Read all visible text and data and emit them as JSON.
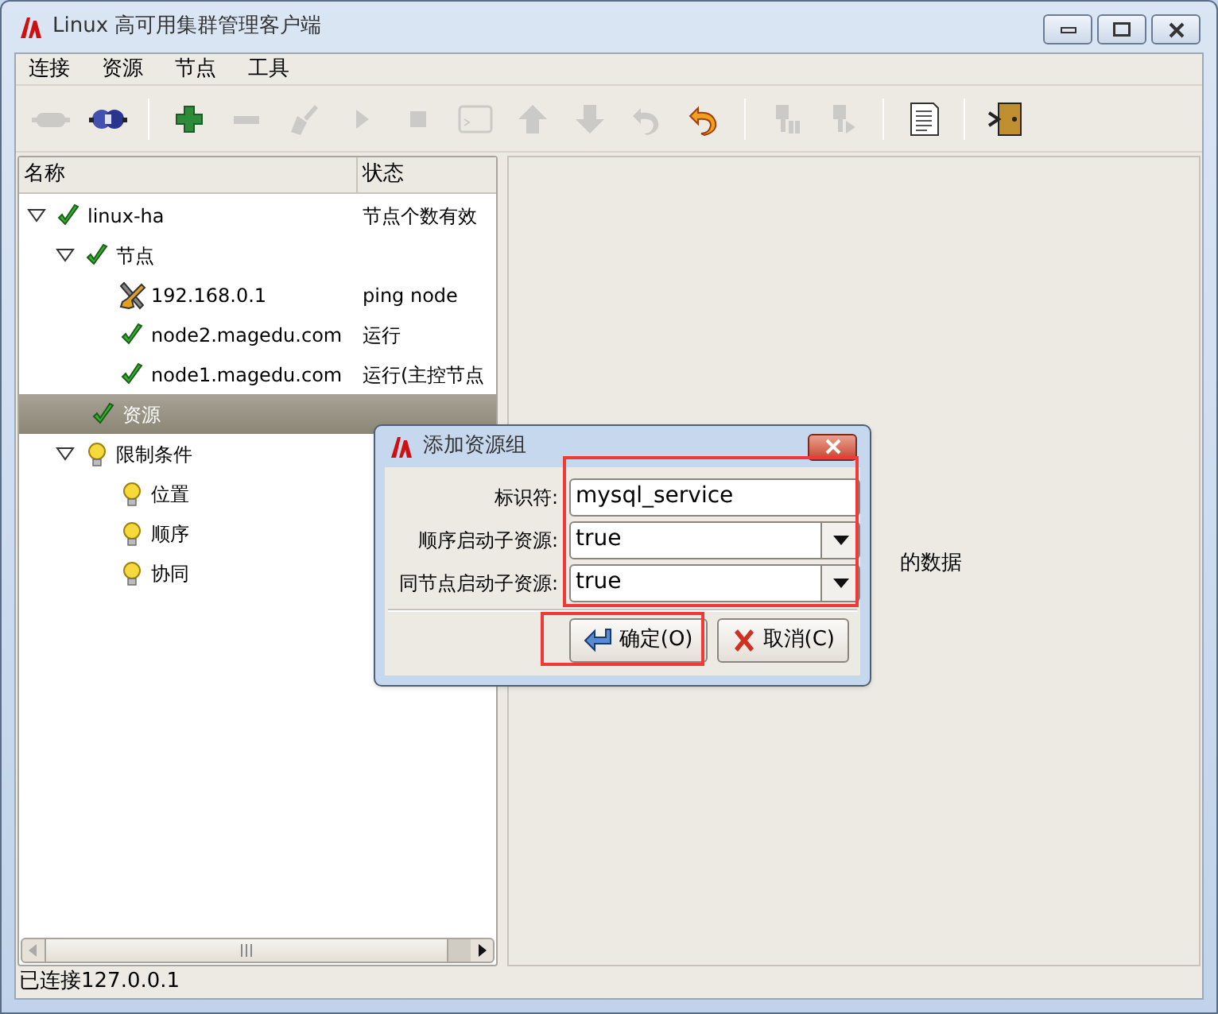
{
  "window": {
    "title": "Linux 高可用集群管理客户端"
  },
  "menu": [
    "连接",
    "资源",
    "节点",
    "工具"
  ],
  "toolbar": [
    {
      "kind": "button",
      "disabled": true
    },
    {
      "kind": "button",
      "disabled": false
    },
    {
      "kind": "separator"
    },
    {
      "kind": "button",
      "disabled": false
    },
    {
      "kind": "button",
      "disabled": true
    },
    {
      "kind": "button",
      "disabled": true
    },
    {
      "kind": "button",
      "disabled": true
    },
    {
      "kind": "button",
      "disabled": true
    },
    {
      "kind": "button",
      "disabled": true
    },
    {
      "kind": "button",
      "disabled": true
    },
    {
      "kind": "button",
      "disabled": true
    },
    {
      "kind": "button",
      "disabled": true
    },
    {
      "kind": "button",
      "disabled": false
    },
    {
      "kind": "separator"
    },
    {
      "kind": "button",
      "disabled": true
    },
    {
      "kind": "button",
      "disabled": true
    },
    {
      "kind": "separator"
    },
    {
      "kind": "button",
      "disabled": false
    },
    {
      "kind": "separator"
    },
    {
      "kind": "button",
      "disabled": false
    }
  ],
  "tree": {
    "columns": [
      "名称",
      "状态"
    ],
    "items": [
      {
        "name": "linux-ha",
        "status": "节点个数有效",
        "kind": "check",
        "expanded": true,
        "selected": false,
        "children": [
          {
            "name": "节点",
            "kind": "check",
            "expanded": true,
            "selected": false,
            "children": [
              {
                "name": "192.168.0.1",
                "status": "ping node",
                "kind": "tools",
                "selected": false
              },
              {
                "name": "node2.magedu.com",
                "status": "运行",
                "kind": "check",
                "selected": false
              },
              {
                "name": "node1.magedu.com",
                "status": "运行(主控节点",
                "kind": "check",
                "selected": false
              }
            ]
          },
          {
            "name": "资源",
            "kind": "check",
            "selected": true
          },
          {
            "name": "限制条件",
            "kind": "bulb",
            "expanded": true,
            "selected": false,
            "children": [
              {
                "name": "位置",
                "kind": "bulb",
                "selected": false
              },
              {
                "name": "顺序",
                "kind": "bulb",
                "selected": false
              },
              {
                "name": "协同",
                "kind": "bulb",
                "selected": false
              }
            ]
          }
        ]
      }
    ]
  },
  "right_panel": {
    "text": "的数据"
  },
  "dialog": {
    "title": "添加资源组",
    "fields": [
      {
        "label": "标识符:",
        "kind": "text",
        "value": "mysql_service"
      },
      {
        "label": "顺序启动子资源:",
        "kind": "combo",
        "value": "true"
      },
      {
        "label": "同节点启动子资源:",
        "kind": "combo",
        "value": "true"
      }
    ],
    "buttons": [
      "确定(O)",
      "取消(C)"
    ]
  },
  "status_bar": "已连接127.0.0.1"
}
